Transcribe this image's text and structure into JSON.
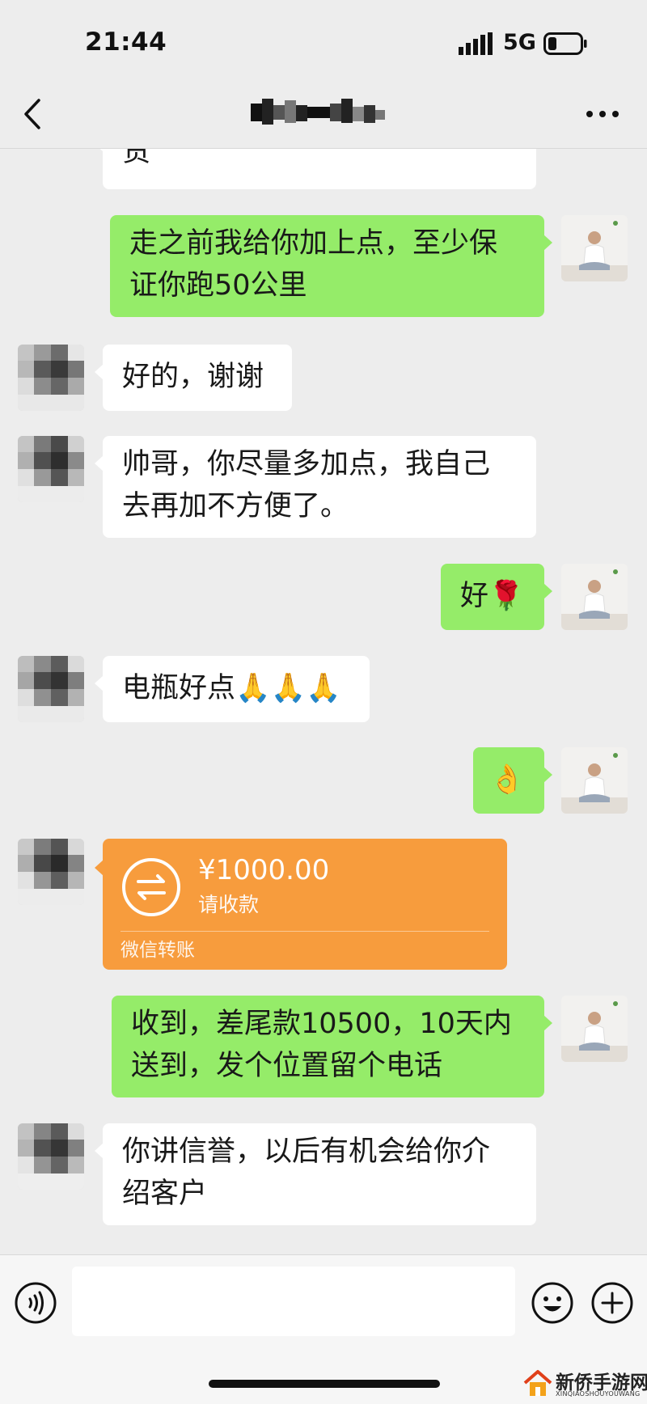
{
  "status_bar": {
    "time": "21:44",
    "network": "5G"
  },
  "header": {
    "back_icon": "chevron-left-icon",
    "more_icon": "ellipsis-icon"
  },
  "messages": [
    {
      "side": "in",
      "text": "货"
    },
    {
      "side": "out",
      "text": "走之前我给你加上点，至少保证你跑50公里"
    },
    {
      "side": "in",
      "text": "好的，谢谢"
    },
    {
      "side": "in",
      "text": "帅哥，你尽量多加点，我自己去再加不方便了。"
    },
    {
      "side": "out",
      "text": "好🌹"
    },
    {
      "side": "in",
      "text": "电瓶好点🙏🙏🙏"
    },
    {
      "side": "out",
      "text": "👌"
    },
    {
      "side": "in",
      "type": "transfer",
      "amount": "¥1000.00",
      "status": "请收款",
      "footer": "微信转账"
    },
    {
      "side": "out",
      "text": "收到，差尾款10500，10天内送到，发个位置留个电话"
    },
    {
      "side": "in",
      "text": "你讲信誉，以后有机会给你介绍客户"
    }
  ],
  "input_bar": {
    "voice_icon": "voice-icon",
    "emoji_icon": "emoji-icon",
    "plus_icon": "plus-icon",
    "placeholder": ""
  },
  "watermark": {
    "text": "新侨手游网",
    "sub": "XINQIAOSHOUYOUWANG"
  },
  "colors": {
    "out_bubble": "#95ec69",
    "in_bubble": "#ffffff",
    "transfer": "#f79c3d",
    "background": "#ededed"
  }
}
